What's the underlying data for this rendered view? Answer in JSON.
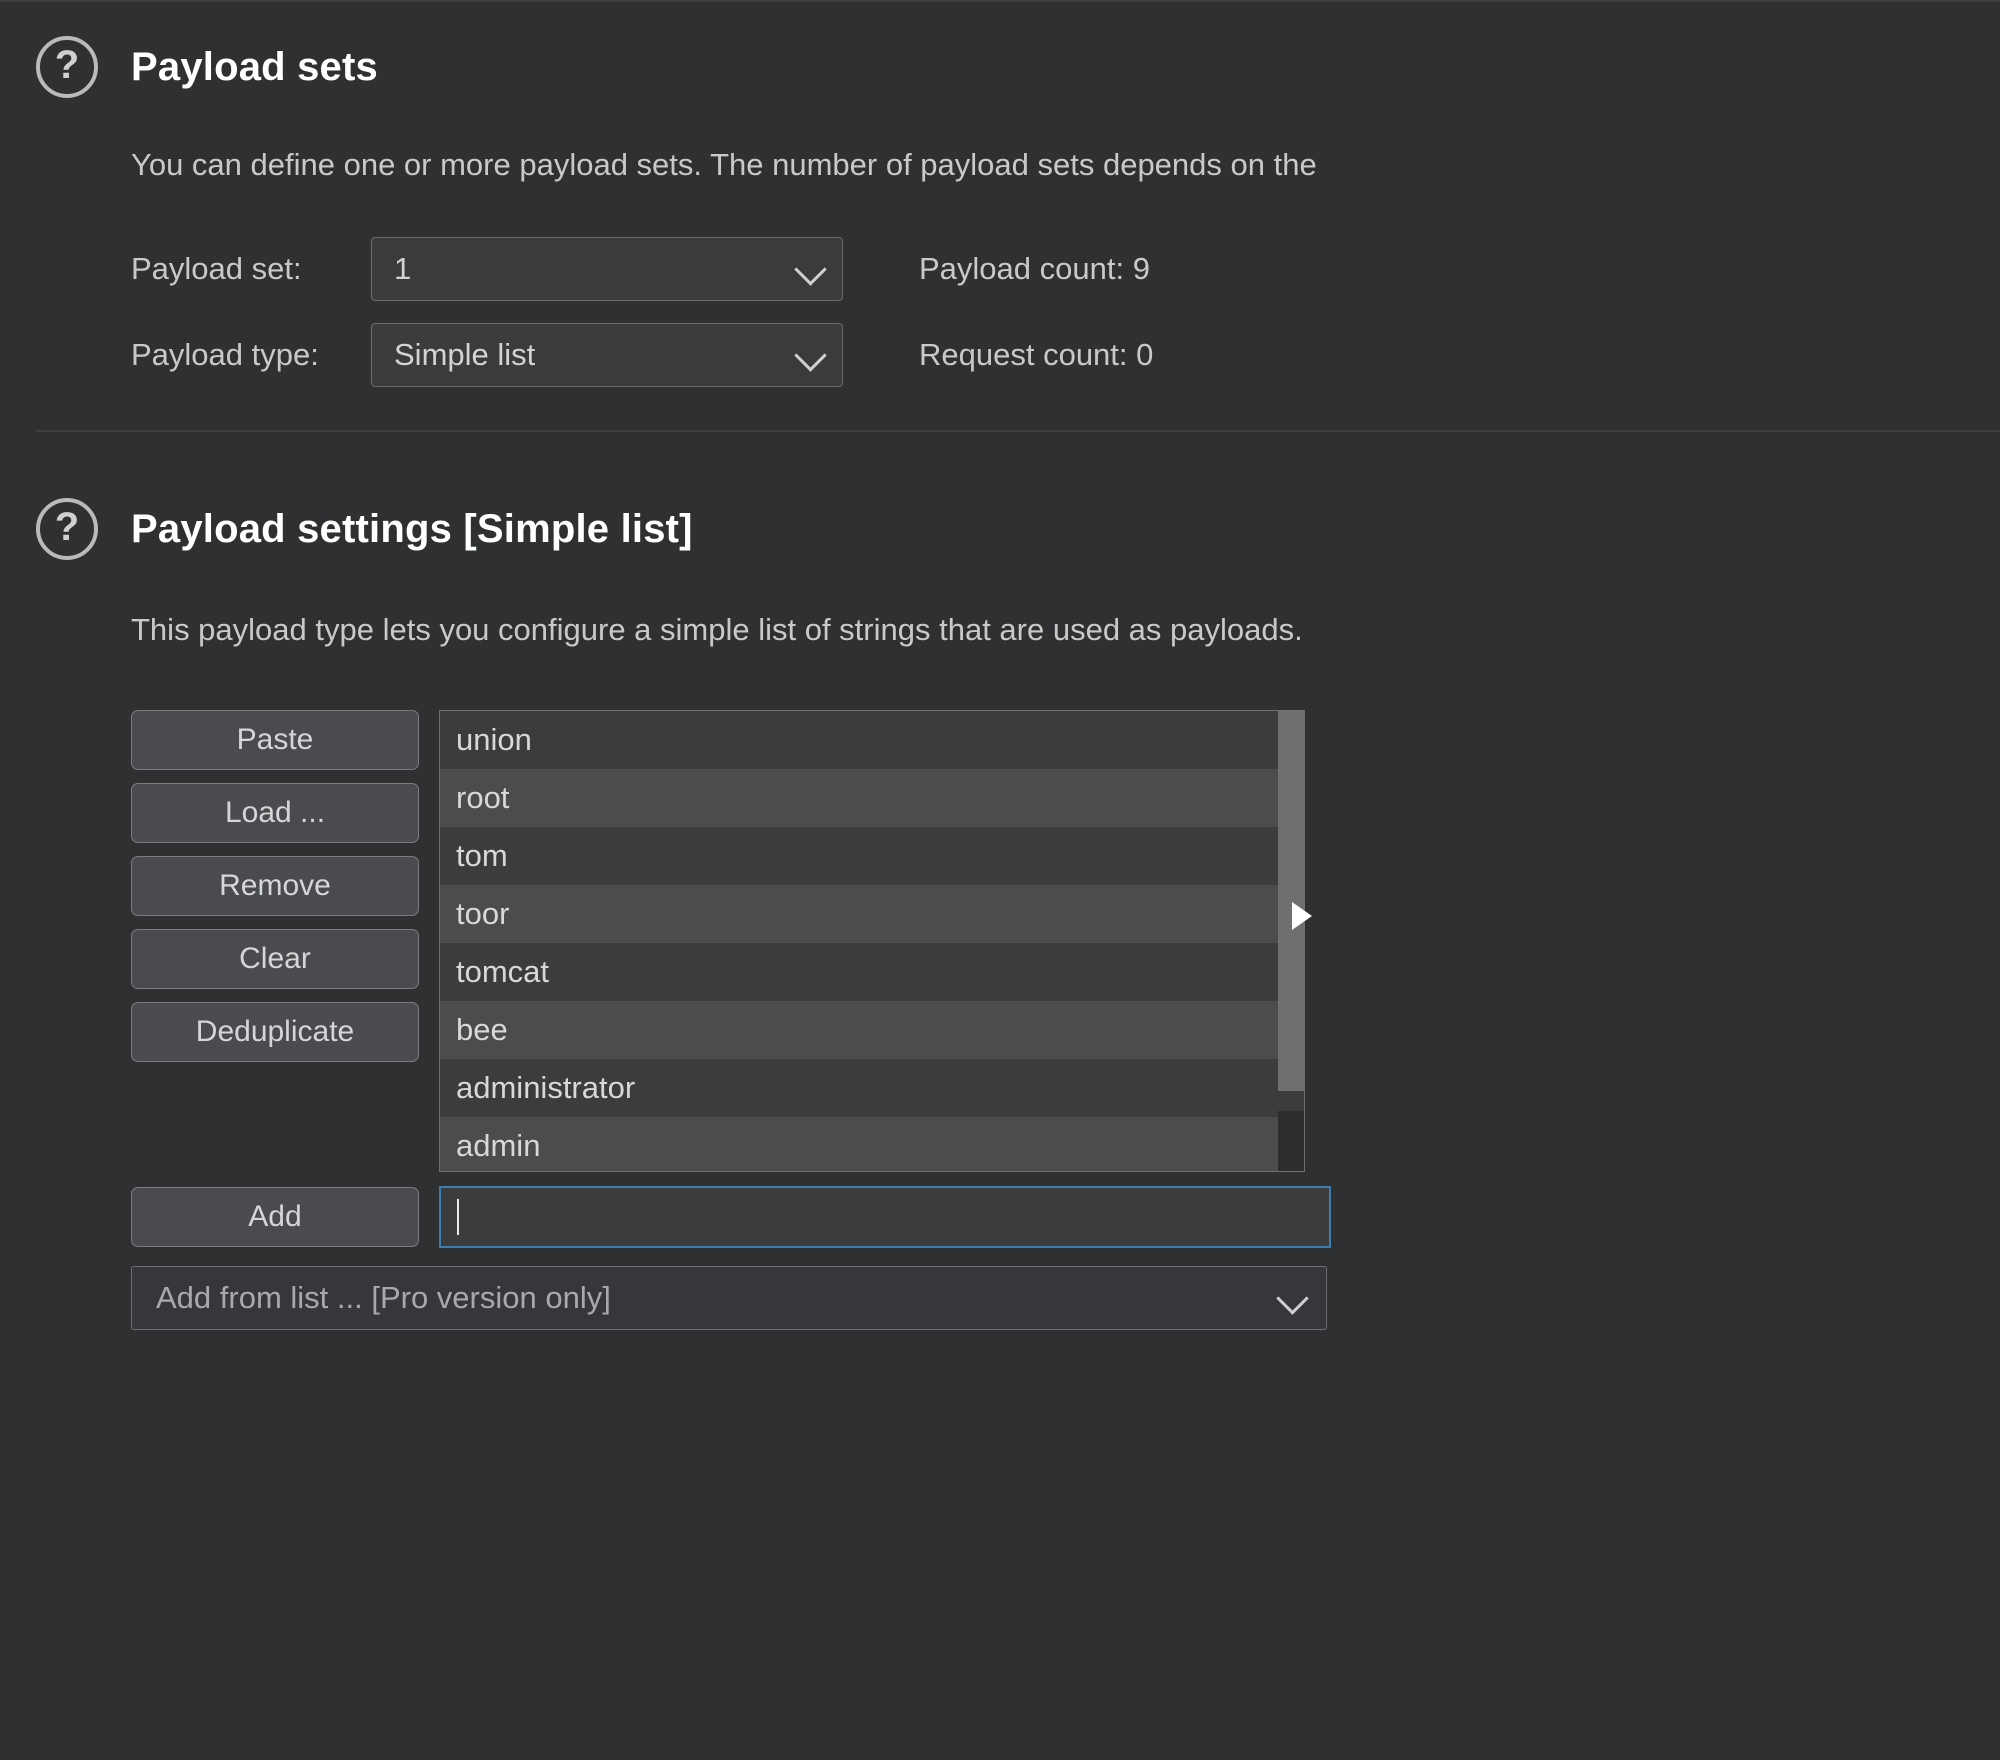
{
  "payload_sets": {
    "icon": "help-circle-icon",
    "title": "Payload sets",
    "description": "You can define one or more payload sets. The number of payload sets depends on the",
    "payload_set_label": "Payload set:",
    "payload_set_value": "1",
    "payload_type_label": "Payload type:",
    "payload_type_value": "Simple list",
    "payload_count": "Payload count: 9",
    "request_count": "Request count: 0",
    "chevron_icon": "chevron-down-icon"
  },
  "payload_settings": {
    "icon": "help-circle-icon",
    "title": "Payload settings [Simple list]",
    "description": "This payload type lets you configure a simple list of strings that are used as payloads.",
    "buttons": [
      {
        "label": "Paste",
        "name": "paste-button"
      },
      {
        "label": "Load ...",
        "name": "load-button"
      },
      {
        "label": "Remove",
        "name": "remove-button"
      },
      {
        "label": "Clear",
        "name": "clear-button"
      },
      {
        "label": "Deduplicate",
        "name": "deduplicate-button"
      }
    ],
    "payload_items": [
      "union",
      "root",
      "tom",
      "toor",
      "tomcat",
      "bee",
      "administrator",
      "admin"
    ],
    "add_button_label": "Add",
    "add_input_value": "",
    "add_from_list_label": "Add from list ... [Pro version only]",
    "chevron_icon": "chevron-down-icon",
    "scrollbar_name": "payload-list-scrollbar"
  },
  "colors": {
    "background": "#2f3032",
    "panel": "#3b3c3e",
    "row_alt": "#4b4c4e",
    "button": "#4a4b4e",
    "focus_border": "#3f7cb0",
    "text": "#c8c9ca",
    "title": "#ffffff"
  }
}
